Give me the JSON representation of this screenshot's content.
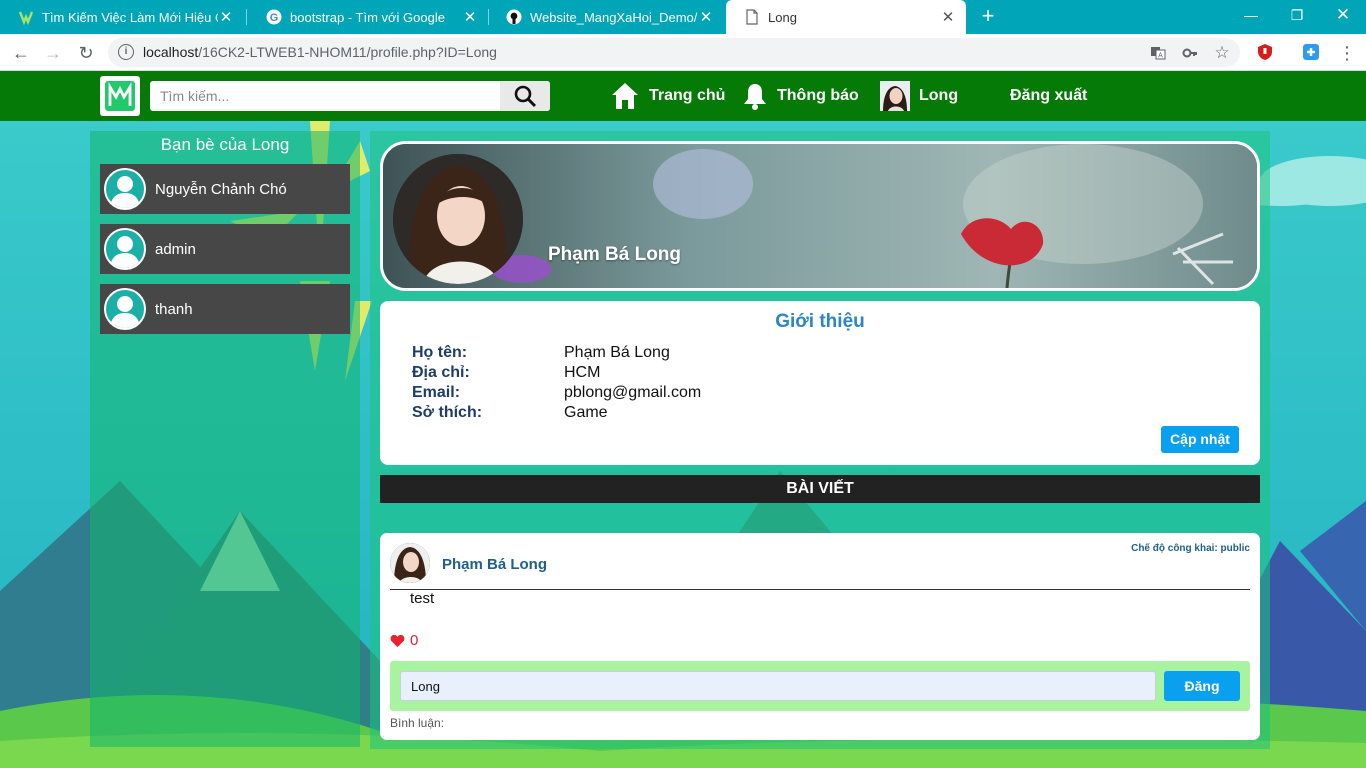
{
  "browser": {
    "tabs": [
      {
        "title": "Tìm Kiếm Việc Làm Mới Hiệu Quả",
        "favicon": "vietnamworks-icon",
        "active": false
      },
      {
        "title": "bootstrap - Tìm với Google",
        "favicon": "google-icon",
        "active": false
      },
      {
        "title": "Website_MangXaHoi_Demo/README",
        "favicon": "github-icon",
        "active": false
      },
      {
        "title": "Long",
        "favicon": "page-icon",
        "active": true
      }
    ],
    "url_host": "localhost",
    "url_path": "/16CK2-LTWEB1-NHOM11/profile.php?ID=Long",
    "colors": {
      "tabbar": "#00a6b8"
    }
  },
  "nav": {
    "search_placeholder": "Tìm kiếm...",
    "home_label": "Trang chủ",
    "notifications_label": "Thông báo",
    "profile_label": "Long",
    "logout_label": "Đăng xuất",
    "colors": {
      "navbar": "#067a06"
    }
  },
  "sidebar": {
    "title": "Bạn bè của Long",
    "friends": [
      "Nguyễn Chảnh Chó",
      "admin",
      "thanh"
    ]
  },
  "profile": {
    "name": "Phạm Bá Long",
    "intro_title": "Giới thiệu",
    "fields": [
      {
        "label": "Họ tên:",
        "value": "Phạm Bá Long"
      },
      {
        "label": "Địa chỉ:",
        "value": "HCM"
      },
      {
        "label": "Email:",
        "value": "pblong@gmail.com"
      },
      {
        "label": "Sở thích:",
        "value": "Game"
      }
    ],
    "update_label": "Cập nhật"
  },
  "posts": {
    "header": "BÀI VIẾT",
    "items": [
      {
        "author": "Phạm Bá Long",
        "privacy": "Chế độ công khai: public",
        "content": "test",
        "likes": "0",
        "comment_value": "Long",
        "post_label": "Đăng",
        "comment_label": "Bình luận:"
      }
    ]
  },
  "colors": {
    "accent": "#0aa0f0",
    "title_blue": "#2b86c5",
    "like_red": "#e8222e"
  }
}
